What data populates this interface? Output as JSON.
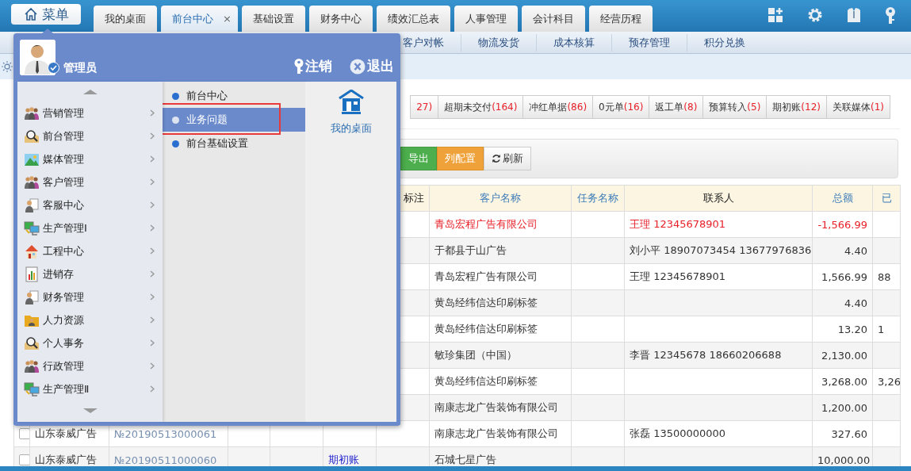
{
  "menu_button": {
    "label": "菜单"
  },
  "tabs": [
    {
      "label": "我的桌面",
      "selected": false
    },
    {
      "label": "前台中心",
      "selected": true,
      "close": "×"
    },
    {
      "label": "基础设置",
      "selected": false
    },
    {
      "label": "财务中心",
      "selected": false
    },
    {
      "label": "绩效汇总表",
      "selected": false
    },
    {
      "label": "人事管理",
      "selected": false
    },
    {
      "label": "会计科目",
      "selected": false
    },
    {
      "label": "经营历程",
      "selected": false
    }
  ],
  "sub_nav": [
    "客户对帐",
    "物流发货",
    "成本核算",
    "预存管理",
    "积分兑换"
  ],
  "filters": [
    {
      "count": "27)"
    },
    {
      "label": "超期未交付",
      "count": "(164)"
    },
    {
      "label": "冲红单据",
      "count": "(86)"
    },
    {
      "label": "0元单",
      "count": "(16)"
    },
    {
      "label": "返工单",
      "count": "(8)"
    },
    {
      "label": "预算转入",
      "count": "(5)"
    },
    {
      "label": "期初账",
      "count": "(12)"
    },
    {
      "label": "关联媒体",
      "count": "(1)"
    }
  ],
  "toolbar": [
    {
      "label": "导出",
      "kind": "export"
    },
    {
      "label": "列配置",
      "kind": "columns"
    },
    {
      "label": "刷新",
      "kind": "refresh"
    }
  ],
  "table": {
    "columns": [
      {
        "label": "标注",
        "sortable": false
      },
      {
        "label": "客户名称",
        "sortable": true
      },
      {
        "label": "任务名称",
        "sortable": true
      },
      {
        "label": "联系人",
        "sortable": false
      },
      {
        "label": "总额",
        "sortable": true
      },
      {
        "label": "已",
        "sortable": true
      }
    ],
    "rows": [
      {
        "highlighted": true,
        "customer_name": "青岛宏程广告有限公司",
        "contact": "王理 12345678901",
        "total": "-1,566.99"
      },
      {
        "highlighted": false,
        "customer_name": "于都县于山广告",
        "contact": "刘小平 18907073454 13677976836",
        "total": "4.40"
      },
      {
        "highlighted": false,
        "customer_name": "青岛宏程广告有限公司",
        "contact": "王理 12345678901",
        "total": "1,566.99",
        "column_12": "88"
      },
      {
        "highlighted": false,
        "customer_name": "黄岛经纬信达印刷标签",
        "total": "4.40"
      },
      {
        "highlighted": false,
        "customer_name": "黄岛经纬信达印刷标签",
        "total": "13.20",
        "column_12": "1"
      },
      {
        "highlighted": false,
        "customer_name": "敏珍集团（中国）",
        "contact": "李晋 12345678 18660206688",
        "total": "2,130.00"
      },
      {
        "highlighted": false,
        "customer_name": "黄岛经纬信达印刷标签",
        "total": "3,268.00",
        "column_12": "3,26"
      },
      {
        "highlighted": false,
        "customer_name": "南康志龙广告装饰有限公司",
        "total": "1,200.00"
      },
      {
        "highlighted": false,
        "checked": false,
        "column_1": "山东泰威广告",
        "column_2": "№20190513000061",
        "customer_name": "南康志龙广告装饰有限公司",
        "contact": "张磊 13500000000",
        "total": "327.60"
      },
      {
        "highlighted": false,
        "checked": false,
        "column_1": "山东泰威广告",
        "column_2": "№20190511000060",
        "column_5": "期初账",
        "customer_name": "石城七星广告",
        "total": "10,000.00"
      }
    ]
  },
  "start_menu": {
    "user": "管理员",
    "actions": [
      {
        "label": "注销",
        "kind": "logout"
      },
      {
        "label": "退出",
        "kind": "exit"
      }
    ],
    "categories": [
      "营销管理",
      "前台管理",
      "媒体管理",
      "客户管理",
      "客服中心",
      "生产管理Ⅰ",
      "工程中心",
      "进销存",
      "财务管理",
      "人力资源",
      "个人事务",
      "行政管理",
      "生产管理Ⅱ"
    ],
    "submenu": [
      {
        "label": "前台中心",
        "selected": false
      },
      {
        "label": "业务问题",
        "selected": true
      },
      {
        "label": "前台基础设置",
        "selected": false
      }
    ],
    "shortcuts": [
      {
        "label": "我的桌面"
      }
    ]
  }
}
